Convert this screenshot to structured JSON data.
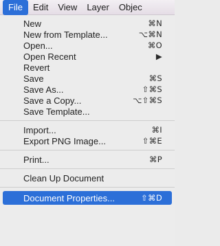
{
  "menubar": {
    "items": [
      "File",
      "Edit",
      "View",
      "Layer",
      "Objec"
    ]
  },
  "menu": {
    "group1": [
      {
        "label": "New",
        "shortcut": "⌘N"
      },
      {
        "label": "New from Template...",
        "shortcut": "⌥⌘N"
      },
      {
        "label": "Open...",
        "shortcut": "⌘O"
      },
      {
        "label": "Open Recent",
        "shortcut": "▶"
      },
      {
        "label": "Revert",
        "shortcut": ""
      },
      {
        "label": "Save",
        "shortcut": "⌘S"
      },
      {
        "label": "Save As...",
        "shortcut": "⇧⌘S"
      },
      {
        "label": "Save a Copy...",
        "shortcut": "⌥⇧⌘S"
      },
      {
        "label": "Save Template...",
        "shortcut": ""
      }
    ],
    "group2": [
      {
        "label": "Import...",
        "shortcut": "⌘I"
      },
      {
        "label": "Export PNG Image...",
        "shortcut": "⇧⌘E"
      }
    ],
    "group3": [
      {
        "label": "Print...",
        "shortcut": "⌘P"
      }
    ],
    "group4": [
      {
        "label": "Clean Up Document",
        "shortcut": ""
      }
    ],
    "group5": [
      {
        "label": "Document Properties...",
        "shortcut": "⇧⌘D"
      }
    ]
  },
  "colors": {
    "highlight": "#2c6fd8",
    "menu_bg": "#ececec"
  }
}
